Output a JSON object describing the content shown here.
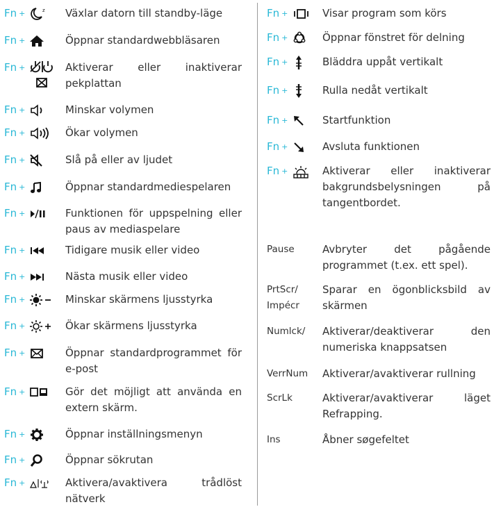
{
  "fn_label": "Fn",
  "plus": "+",
  "left_shortcuts": [
    {
      "icon": "moon-standby-icon",
      "text": "Växlar datorn till standby-läge"
    },
    {
      "icon": "home-icon",
      "text": "Öppnar standardwebbläsaren"
    },
    {
      "icon": "touchpad-toggle-icon",
      "text": "Aktiverar eller inaktiverar pekplattan"
    },
    {
      "icon": "volume-down-icon",
      "text": "Minskar volymen"
    },
    {
      "icon": "volume-up-icon",
      "text": "Ökar volymen"
    },
    {
      "icon": "mute-icon",
      "text": "Slå på eller av ljudet"
    },
    {
      "icon": "music-note-icon",
      "text": "Öppnar standardmediespelaren"
    },
    {
      "icon": "play-pause-icon",
      "text": "Funktionen för uppspelning eller paus av mediaspelare"
    },
    {
      "icon": "previous-track-icon",
      "text": "Tidigare musik eller video"
    },
    {
      "icon": "next-track-icon",
      "text": "Nästa musik eller video"
    },
    {
      "icon": "brightness-down-icon",
      "text": "Minskar skärmens ljusstyrka"
    },
    {
      "icon": "brightness-up-icon",
      "text": "Ökar skärmens ljusstyrka"
    },
    {
      "icon": "mail-icon",
      "text": "Öppnar standardprogrammet för e-post"
    },
    {
      "icon": "external-display-icon",
      "text": "Gör det möjligt att använda en extern skärm."
    },
    {
      "icon": "gear-icon",
      "text": "Öppnar inställningsmenyn"
    },
    {
      "icon": "search-icon",
      "text": "Öppnar sökrutan"
    },
    {
      "icon": "wireless-icon",
      "text": "Aktivera/avaktivera trådlöst nätverk"
    }
  ],
  "right_shortcuts": [
    {
      "icon": "task-view-icon",
      "text": "Visar program som körs"
    },
    {
      "icon": "share-icon",
      "text": "Öppnar fönstret för delning"
    },
    {
      "icon": "scroll-up-icon",
      "text": "Bläddra uppåt vertikalt"
    },
    {
      "icon": "scroll-down-icon",
      "text": "Rulla nedåt vertikalt"
    },
    {
      "icon": "home-arrow-icon",
      "text": "Startfunktion"
    },
    {
      "icon": "end-arrow-icon",
      "text": "Avsluta funktionen"
    },
    {
      "icon": "keyboard-backlight-icon",
      "text": "Aktiverar eller inaktiverar bakgrundsbelysningen på tangentbordet."
    }
  ],
  "special_keys": [
    {
      "key": "Pause",
      "text": "Avbryter det pågående programmet (t.ex. ett spel)."
    },
    {
      "key": "PrtScr/ Impécr",
      "text": "Sparar en ögonblicksbild av skärmen"
    },
    {
      "key": "Numlck/",
      "text": "Aktiverar/deaktiverar den numeriska knappsatsen"
    },
    {
      "key": "VerrNum",
      "text": "Aktiverar/avaktiverar rullning"
    },
    {
      "key": "ScrLk",
      "text": "Aktiverar/avaktiverar läget Refrapping."
    },
    {
      "key": "Ins",
      "text": "Åbner søgefeltet"
    }
  ],
  "colors": {
    "fn": "#29b8d6",
    "text": "#333333",
    "divider": "#9a9a9a"
  }
}
